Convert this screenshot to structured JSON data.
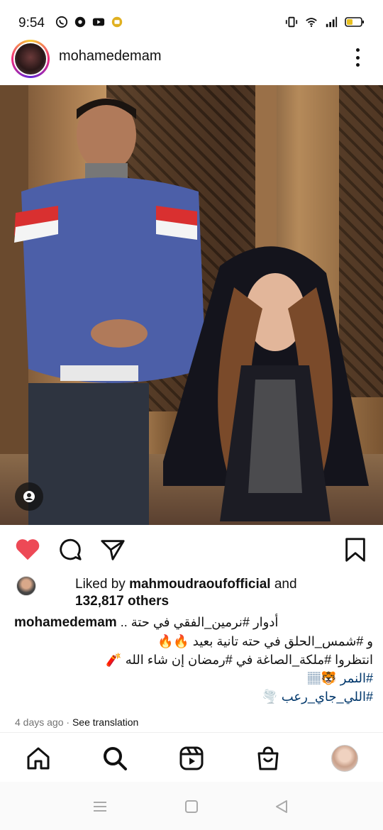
{
  "status_bar": {
    "time": "9:54",
    "left_icons": [
      "whatsapp-icon",
      "whatsapp-business-icon",
      "youtube-icon",
      "notification-icon"
    ],
    "right_icons": [
      "vibrate-icon",
      "wifi-icon",
      "signal-icon",
      "battery-icon"
    ]
  },
  "post": {
    "username": "mohamedemam",
    "liked_by_prefix": "Liked by",
    "liked_by_user": "mahmoudraoufofficial",
    "liked_by_and": "and",
    "others_count": "132,817 others",
    "caption": {
      "owner": "mohamedemam",
      "line1": "أدوار #نرمين_الفقي في حتة ..",
      "line2": "و #شمس_الحلق في حته تانية بعيد 🔥🔥",
      "line3": "انتظروا #ملكة_الصاغة في #رمضان إن شاء الله 🧨",
      "line4": "#النمر 🐯🏽",
      "line5": "#اللي_جاي_رعب 🌪️"
    },
    "time_ago": "4 days ago",
    "separator": "·",
    "see_translation": "See translation"
  },
  "colors": {
    "like_red": "#ed4956",
    "text": "#111111",
    "secondary": "#737373",
    "link": "#00376b"
  }
}
